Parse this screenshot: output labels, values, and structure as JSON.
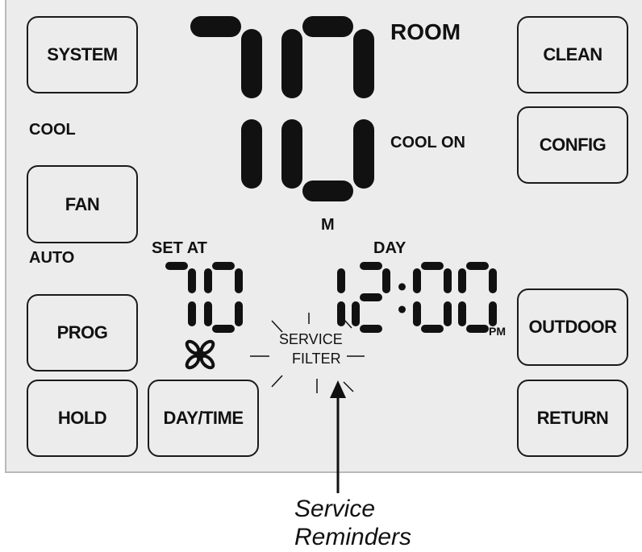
{
  "buttons": {
    "system": "SYSTEM",
    "fan": "FAN",
    "prog": "PROG",
    "hold": "HOLD",
    "day_time": "DAY/TIME",
    "clean": "CLEAN",
    "config": "CONFIG",
    "outdoor": "OUTDOOR",
    "return": "RETURN"
  },
  "indicators": {
    "room": "ROOM",
    "cool": "COOL",
    "cool_on": "COOL ON",
    "auto": "AUTO",
    "set_at": "SET AT",
    "m": "M",
    "day": "DAY",
    "pm": "PM",
    "service": "SERVICE",
    "filter": "FILTER"
  },
  "display": {
    "room_temp": "70",
    "setpoint": "70",
    "time": "12:00"
  },
  "caption": {
    "line1": "Service",
    "line2": "Reminders"
  },
  "icons": [
    "fan-icon",
    "arrow-up-icon"
  ],
  "colors": {
    "lcd_background": "#ececec",
    "segment": "#111111"
  }
}
